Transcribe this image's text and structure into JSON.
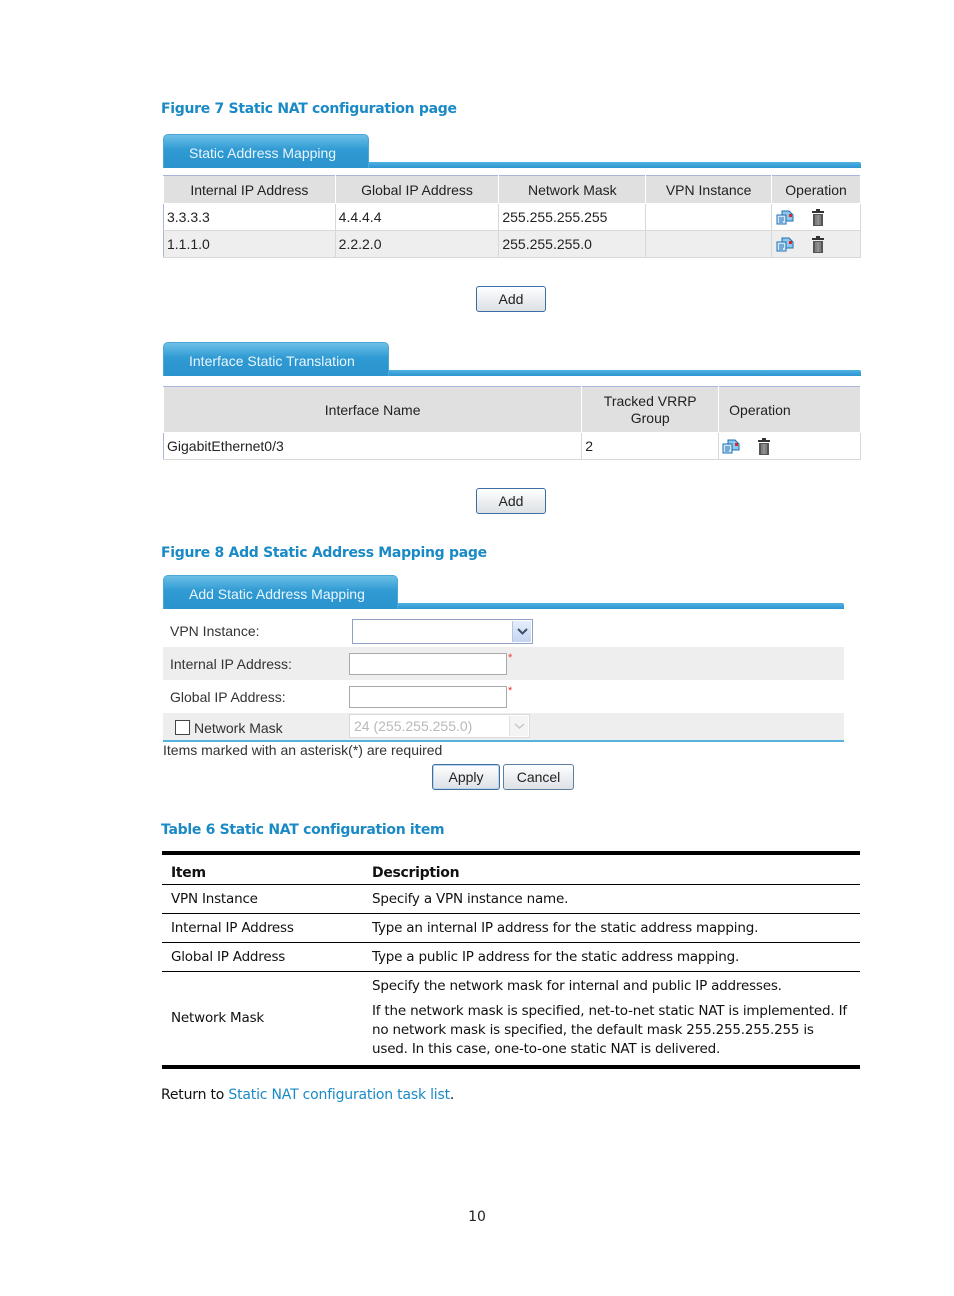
{
  "figure7": {
    "caption": "Figure 7 Static NAT configuration page",
    "static_mapping": {
      "tab_label": "Static Address Mapping",
      "columns": [
        "Internal IP Address",
        "Global IP Address",
        "Network Mask",
        "VPN Instance",
        "Operation"
      ],
      "rows": [
        {
          "internal_ip": "3.3.3.3",
          "global_ip": "4.4.4.4",
          "network_mask": "255.255.255.255",
          "vpn_instance": "",
          "operations": [
            "edit-icon",
            "delete-icon"
          ]
        },
        {
          "internal_ip": "1.1.1.0",
          "global_ip": "2.2.2.0",
          "network_mask": "255.255.255.0",
          "vpn_instance": "",
          "operations": [
            "edit-icon",
            "delete-icon"
          ]
        }
      ],
      "add_label": "Add"
    },
    "interface_translation": {
      "tab_label": "Interface Static Translation",
      "columns": [
        "Interface Name",
        "Tracked VRRP Group",
        "Operation"
      ],
      "rows": [
        {
          "interface_name": "GigabitEthernet0/3",
          "tracked_vrrp_group": "2",
          "operations": [
            "edit-icon",
            "delete-icon"
          ]
        }
      ],
      "add_label": "Add"
    }
  },
  "figure8": {
    "caption": "Figure 8 Add Static Address Mapping page",
    "tab_label": "Add Static Address Mapping",
    "fields": {
      "vpn_instance": {
        "label": "VPN Instance:",
        "value": ""
      },
      "internal_ip": {
        "label": "Internal IP Address:",
        "value": "",
        "required_mark": "*"
      },
      "global_ip": {
        "label": "Global IP Address:",
        "value": "",
        "required_mark": "*"
      },
      "network_mask": {
        "label": "Network Mask",
        "checked": false,
        "value": "24 (255.255.255.0)",
        "disabled": true
      }
    },
    "note": "Items marked with an asterisk(*) are required",
    "apply_label": "Apply",
    "cancel_label": "Cancel"
  },
  "table6": {
    "caption": "Table 6 Static NAT configuration item",
    "headers": [
      "Item",
      "Description"
    ],
    "rows": [
      {
        "item": "VPN Instance",
        "description": [
          "Specify a VPN instance name."
        ]
      },
      {
        "item": "Internal IP Address",
        "description": [
          "Type an internal IP address for the static address mapping."
        ]
      },
      {
        "item": "Global IP Address",
        "description": [
          "Type a public IP address for the static address mapping."
        ]
      },
      {
        "item": "Network Mask",
        "description": [
          "Specify the network mask for internal and public IP addresses.",
          "If the network mask is specified, net-to-net static NAT is implemented. If no network mask is specified, the default mask 255.255.255.255 is used. In this case, one-to-one static NAT is delivered."
        ]
      }
    ]
  },
  "footer": {
    "return_prefix": "Return to ",
    "return_link": "Static NAT configuration task list",
    "return_suffix": ".",
    "page_number": "10"
  }
}
